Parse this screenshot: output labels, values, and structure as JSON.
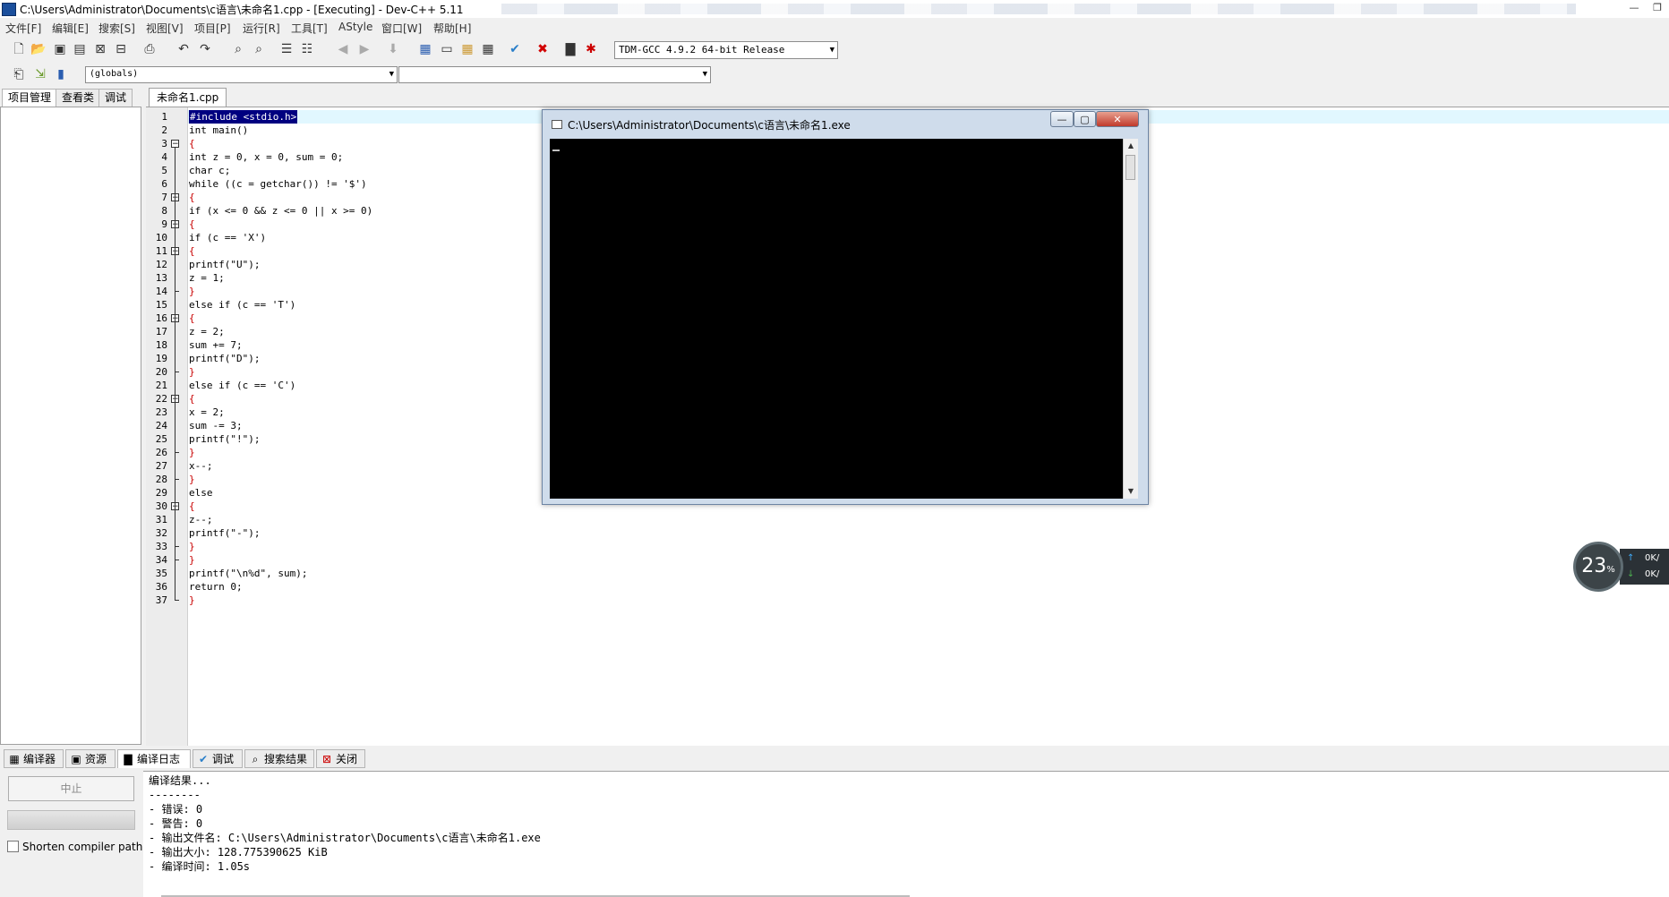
{
  "window": {
    "title": "C:\\Users\\Administrator\\Documents\\c语言\\未命名1.cpp - [Executing] - Dev-C++ 5.11",
    "minimize": "—",
    "restore": "❐"
  },
  "menu": [
    "文件[F]",
    "编辑[E]",
    "搜索[S]",
    "视图[V]",
    "项目[P]",
    "运行[R]",
    "工具[T]",
    "AStyle",
    "窗口[W]",
    "帮助[H]"
  ],
  "toolbar": {
    "compiler_select": "TDM-GCC 4.9.2 64-bit Release",
    "scope_select": "(globals)",
    "function_select": ""
  },
  "left_tabs": [
    "项目管理",
    "查看类",
    "调试"
  ],
  "editor": {
    "tab": "未命名1.cpp",
    "lines": [
      {
        "n": "1",
        "text": "#include <stdio.h>"
      },
      {
        "n": "2",
        "text": "int main()"
      },
      {
        "n": "3",
        "text": "{"
      },
      {
        "n": "4",
        "text": "int z = 0, x = 0, sum = 0;"
      },
      {
        "n": "5",
        "text": "char c;"
      },
      {
        "n": "6",
        "text": "while ((c = getchar()) != '$')"
      },
      {
        "n": "7",
        "text": "{"
      },
      {
        "n": "8",
        "text": "if (x <= 0 && z <= 0 || x >= 0)"
      },
      {
        "n": "9",
        "text": "{"
      },
      {
        "n": "10",
        "text": "if (c == 'X')"
      },
      {
        "n": "11",
        "text": "{"
      },
      {
        "n": "12",
        "text": "printf(\"U\");"
      },
      {
        "n": "13",
        "text": "z = 1;"
      },
      {
        "n": "14",
        "text": "}"
      },
      {
        "n": "15",
        "text": "else if (c == 'T')"
      },
      {
        "n": "16",
        "text": "{"
      },
      {
        "n": "17",
        "text": "z = 2;"
      },
      {
        "n": "18",
        "text": "sum += 7;"
      },
      {
        "n": "19",
        "text": "printf(\"D\");"
      },
      {
        "n": "20",
        "text": "}"
      },
      {
        "n": "21",
        "text": "else if (c == 'C')"
      },
      {
        "n": "22",
        "text": "{"
      },
      {
        "n": "23",
        "text": "x = 2;"
      },
      {
        "n": "24",
        "text": "sum -= 3;"
      },
      {
        "n": "25",
        "text": "printf(\"!\");"
      },
      {
        "n": "26",
        "text": "}"
      },
      {
        "n": "27",
        "text": "x--;"
      },
      {
        "n": "28",
        "text": "}"
      },
      {
        "n": "29",
        "text": "else"
      },
      {
        "n": "30",
        "text": "{"
      },
      {
        "n": "31",
        "text": "z--;"
      },
      {
        "n": "32",
        "text": "printf(\"-\");"
      },
      {
        "n": "33",
        "text": "}"
      },
      {
        "n": "34",
        "text": "}"
      },
      {
        "n": "35",
        "text": "printf(\"\\n%d\", sum);"
      },
      {
        "n": "36",
        "text": "return 0;"
      },
      {
        "n": "37",
        "text": "}"
      }
    ]
  },
  "console": {
    "title": "C:\\Users\\Administrator\\Documents\\c语言\\未命名1.exe",
    "minimize": "—",
    "restore": "▢",
    "close": "✕"
  },
  "net_widget": {
    "percent": "23",
    "unit": "%",
    "up": "0K/",
    "down": "0K/"
  },
  "bottom_tabs": [
    "编译器",
    "资源",
    "编译日志",
    "调试",
    "搜索结果",
    "关闭"
  ],
  "bottom_left": {
    "stop_button": "中止",
    "shorten_label": "Shorten compiler paths"
  },
  "log": [
    "编译结果...",
    "--------",
    "- 错误: 0",
    "- 警告: 0",
    "- 输出文件名: C:\\Users\\Administrator\\Documents\\c语言\\未命名1.exe",
    "- 输出大小: 128.775390625 KiB",
    "- 编译时间: 1.05s"
  ],
  "colors": {
    "accent_selection": "#000080",
    "brace": "#c80000",
    "current_line": "#e1f7ff",
    "console_bg": "#000000"
  }
}
